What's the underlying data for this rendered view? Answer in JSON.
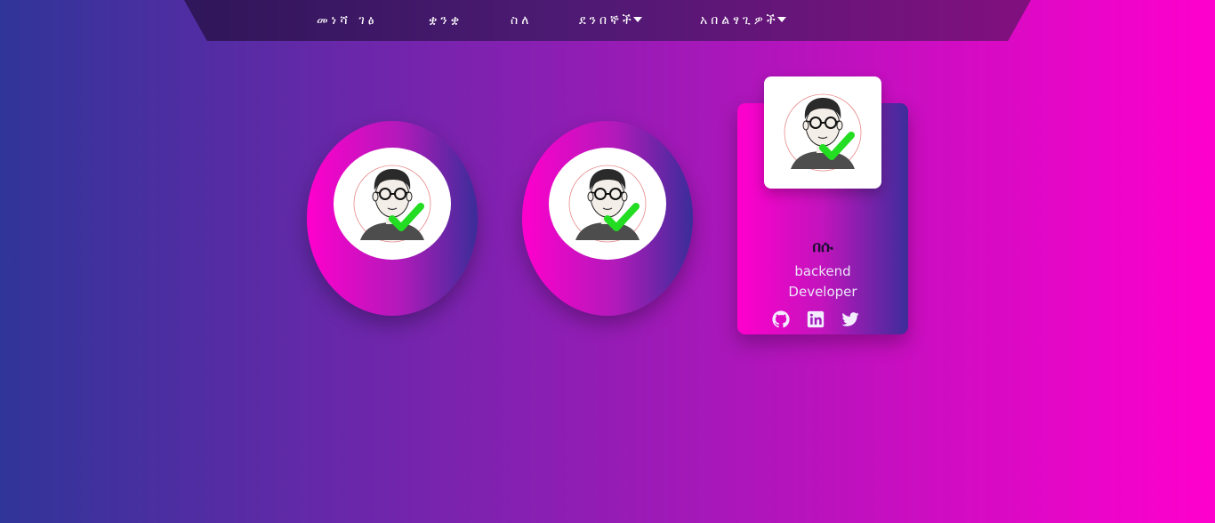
{
  "nav": {
    "items": [
      {
        "label": "መነሻ ገፅ",
        "has_caret": false
      },
      {
        "label": "ቋንቋ",
        "has_caret": false
      },
      {
        "label": "ስለ",
        "has_caret": false
      },
      {
        "label": "ደንበኞች",
        "has_caret": true
      },
      {
        "label": "አበልፃጊዎች",
        "has_caret": true
      }
    ]
  },
  "team": {
    "card": {
      "name": "በሱ",
      "role_line1": "backend",
      "role_line2": "Developer",
      "social": [
        "github-icon",
        "linkedin-icon",
        "twitter-icon"
      ]
    }
  },
  "colors": {
    "background_start": "#303599",
    "background_end": "#ff00cc",
    "nav_bg": "#4d1a73",
    "check": "#22dd22"
  }
}
